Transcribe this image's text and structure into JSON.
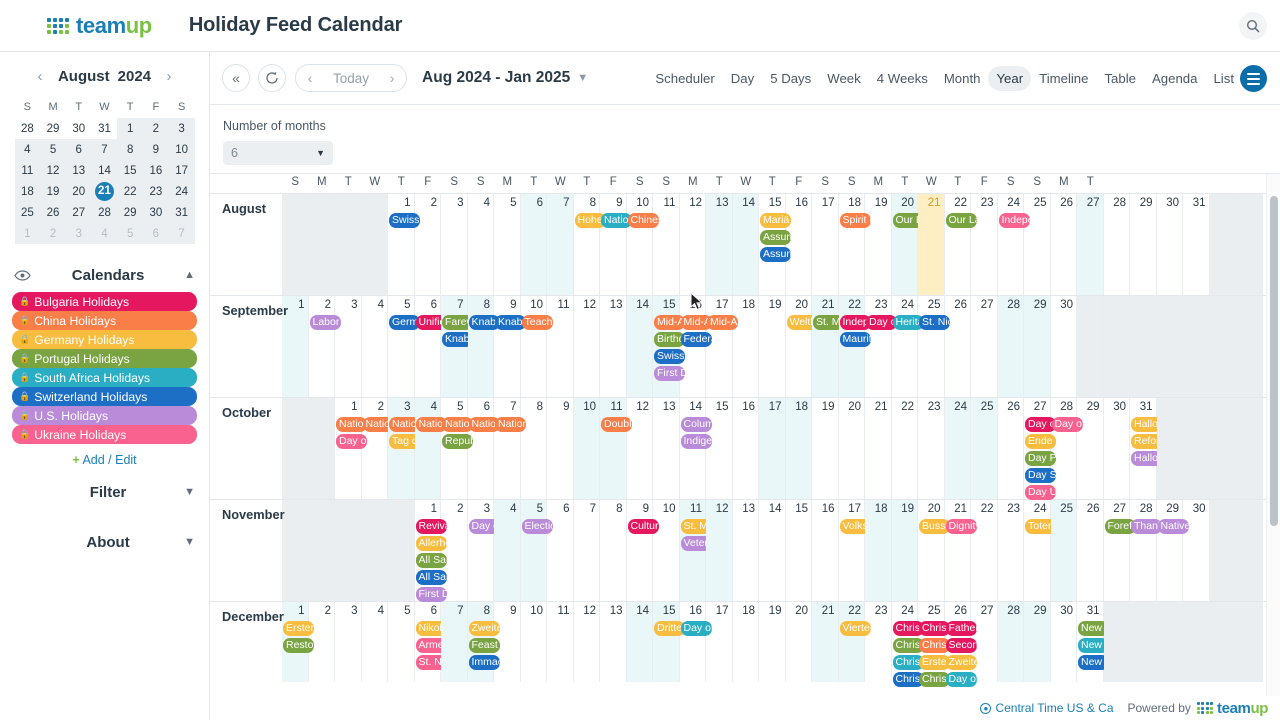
{
  "header": {
    "brand": "teamup",
    "brand_part1": "team",
    "brand_part2": "up",
    "title": "Holiday Feed Calendar",
    "search_icon": "search-icon"
  },
  "sidebar": {
    "mini_calendar": {
      "prev_icon": "chevron-left-icon",
      "next_icon": "chevron-right-icon",
      "month": "August",
      "year": "2024",
      "weekday_headers": [
        "S",
        "M",
        "T",
        "W",
        "T",
        "F",
        "S"
      ],
      "weeks": [
        [
          {
            "d": "28",
            "out": true
          },
          {
            "d": "29",
            "out": true
          },
          {
            "d": "30",
            "out": true
          },
          {
            "d": "31",
            "out": true
          },
          {
            "d": "1"
          },
          {
            "d": "2"
          },
          {
            "d": "3"
          }
        ],
        [
          {
            "d": "4"
          },
          {
            "d": "5"
          },
          {
            "d": "6"
          },
          {
            "d": "7"
          },
          {
            "d": "8"
          },
          {
            "d": "9"
          },
          {
            "d": "10"
          }
        ],
        [
          {
            "d": "11"
          },
          {
            "d": "12"
          },
          {
            "d": "13"
          },
          {
            "d": "14"
          },
          {
            "d": "15"
          },
          {
            "d": "16"
          },
          {
            "d": "17"
          }
        ],
        [
          {
            "d": "18"
          },
          {
            "d": "19"
          },
          {
            "d": "20"
          },
          {
            "d": "21",
            "today": true
          },
          {
            "d": "22"
          },
          {
            "d": "23"
          },
          {
            "d": "24"
          }
        ],
        [
          {
            "d": "25"
          },
          {
            "d": "26"
          },
          {
            "d": "27"
          },
          {
            "d": "28"
          },
          {
            "d": "29"
          },
          {
            "d": "30"
          },
          {
            "d": "31"
          }
        ],
        [
          {
            "d": "1",
            "out": true
          },
          {
            "d": "2",
            "out": true
          },
          {
            "d": "3",
            "out": true
          },
          {
            "d": "4",
            "out": true
          },
          {
            "d": "5",
            "out": true
          },
          {
            "d": "6",
            "out": true
          },
          {
            "d": "7",
            "out": true
          }
        ]
      ]
    },
    "calendars_section": {
      "title": "Calendars",
      "eye_icon": "eye-icon",
      "collapse_icon": "chevron-up-icon",
      "items": [
        {
          "label": "Bulgaria Holidays",
          "color": "#e5175e",
          "locked": true
        },
        {
          "label": "China Holidays",
          "color": "#f97e48",
          "locked": true
        },
        {
          "label": "Germany Holidays",
          "color": "#f8bc3e",
          "locked": true
        },
        {
          "label": "Portugal Holidays",
          "color": "#79a441",
          "locked": true
        },
        {
          "label": "South Africa Holidays",
          "color": "#2aaec4",
          "locked": true
        },
        {
          "label": "Switzerland Holidays",
          "color": "#1d6fc6",
          "locked": true
        },
        {
          "label": "U.S. Holidays",
          "color": "#b98bd8",
          "locked": true
        },
        {
          "label": "Ukraine Holidays",
          "color": "#f9628f",
          "locked": true
        }
      ],
      "add_edit": {
        "plus": "+",
        "label": "Add / Edit"
      }
    },
    "filter_section": {
      "title": "Filter",
      "icon": "chevron-down-icon"
    },
    "about_section": {
      "title": "About",
      "icon": "chevron-down-icon"
    }
  },
  "toolbar": {
    "collapse_icon": "double-chevron-left-icon",
    "refresh_icon": "refresh-icon",
    "prev_icon": "chevron-left-icon",
    "today_label": "Today",
    "next_icon": "chevron-right-icon",
    "range_label": "Aug 2024 - Jan 2025",
    "range_chevron": "chevron-down-icon",
    "views": [
      {
        "label": "Scheduler",
        "active": false
      },
      {
        "label": "Day",
        "active": false
      },
      {
        "label": "5 Days",
        "active": false
      },
      {
        "label": "Week",
        "active": false
      },
      {
        "label": "4 Weeks",
        "active": false
      },
      {
        "label": "Month",
        "active": false
      },
      {
        "label": "Year",
        "active": true
      },
      {
        "label": "Timeline",
        "active": false
      },
      {
        "label": "Table",
        "active": false
      },
      {
        "label": "Agenda",
        "active": false
      },
      {
        "label": "List",
        "active": false
      }
    ],
    "menu_icon": "hamburger-menu-icon"
  },
  "subbar": {
    "months_label": "Number of months",
    "months_value": "6",
    "months_arrow": "caret-down-icon"
  },
  "year_grid": {
    "weekday_headers": [
      "S",
      "M",
      "T",
      "W",
      "T",
      "F",
      "S",
      "S",
      "M",
      "T",
      "W",
      "T",
      "F",
      "S",
      "S",
      "M",
      "T",
      "W",
      "T",
      "F",
      "S",
      "S",
      "M",
      "T",
      "W",
      "T",
      "F",
      "S",
      "S",
      "M",
      "T"
    ],
    "months": [
      {
        "name": "August",
        "pad_before": 4,
        "days": 31,
        "weekend_offsets": [
          2,
          3,
          9,
          10,
          16,
          17,
          23,
          24,
          30
        ],
        "today": 21,
        "events": {
          "1": [
            {
              "t": "Swiss National Day",
              "c": "#1d6fc6"
            }
          ],
          "8": [
            {
              "t": "Hohe Feiertage",
              "c": "#f8bc3e"
            }
          ],
          "9": [
            {
              "t": "National Women's Day",
              "c": "#2aaec4"
            }
          ],
          "10": [
            {
              "t": "Chinese Valentine's Day",
              "c": "#f97e48"
            }
          ],
          "15": [
            {
              "t": "Mariä Himmelfahrt",
              "c": "#f8bc3e"
            },
            {
              "t": "Assumption of Mary",
              "c": "#79a441"
            },
            {
              "t": "Assumption",
              "c": "#1d6fc6"
            }
          ],
          "18": [
            {
              "t": "Spirit Festival",
              "c": "#f97e48"
            }
          ],
          "20": [
            {
              "t": "Our Lady of Sorrows",
              "c": "#79a441"
            }
          ],
          "22": [
            {
              "t": "Our Lady",
              "c": "#79a441"
            }
          ],
          "24": [
            {
              "t": "Independence Day",
              "c": "#f9628f"
            }
          ]
        }
      },
      {
        "name": "September",
        "pad_before": 0,
        "days": 30,
        "weekend_offsets": [
          0,
          6,
          7,
          13,
          14,
          20,
          21,
          27,
          28
        ],
        "events": {
          "2": [
            {
              "t": "Labor Day",
              "c": "#b98bd8"
            }
          ],
          "5": [
            {
              "t": "Germany Holiday",
              "c": "#1d6fc6"
            }
          ],
          "6": [
            {
              "t": "Unification Day",
              "c": "#e5175e"
            }
          ],
          "7": [
            {
              "t": "Farewell",
              "c": "#79a441"
            },
            {
              "t": "Knabenschiessen",
              "c": "#1d6fc6"
            }
          ],
          "8": [
            {
              "t": "Knabenschiessen",
              "c": "#1d6fc6"
            }
          ],
          "9": [
            {
              "t": "Knabenschiessen",
              "c": "#1d6fc6"
            }
          ],
          "10": [
            {
              "t": "Teacher's Day",
              "c": "#f97e48"
            }
          ],
          "15": [
            {
              "t": "Mid-Autumn Festival",
              "c": "#f97e48"
            },
            {
              "t": "Birthday",
              "c": "#79a441"
            },
            {
              "t": "Swiss Holiday",
              "c": "#1d6fc6"
            },
            {
              "t": "First Day",
              "c": "#b98bd8"
            }
          ],
          "16": [
            {
              "t": "Mid-Autumn Festival",
              "c": "#f97e48"
            },
            {
              "t": "Federal Fast",
              "c": "#1d6fc6"
            }
          ],
          "17": [
            {
              "t": "Mid-Autumn Festival",
              "c": "#f97e48"
            }
          ],
          "20": [
            {
              "t": "Weltkindertag",
              "c": "#f8bc3e"
            }
          ],
          "21": [
            {
              "t": "St. Matthew",
              "c": "#79a441"
            }
          ],
          "22": [
            {
              "t": "Independence Day",
              "c": "#e5175e"
            },
            {
              "t": "Mauritius",
              "c": "#1d6fc6"
            }
          ],
          "23": [
            {
              "t": "Day of Unity",
              "c": "#e5175e"
            }
          ],
          "24": [
            {
              "t": "Heritage Day",
              "c": "#2aaec4"
            }
          ],
          "25": [
            {
              "t": "St. Nicholas",
              "c": "#1d6fc6"
            }
          ]
        }
      },
      {
        "name": "October",
        "pad_before": 2,
        "days": 31,
        "weekend_offsets": [
          4,
          5,
          11,
          12,
          18,
          19,
          25,
          26
        ],
        "events": {
          "1": [
            {
              "t": "National Day",
              "c": "#f97e48"
            },
            {
              "t": "Day of Defenders",
              "c": "#f9628f"
            }
          ],
          "2": [
            {
              "t": "National Day",
              "c": "#f97e48"
            }
          ],
          "3": [
            {
              "t": "National Day",
              "c": "#f97e48"
            },
            {
              "t": "Tag der Einheit",
              "c": "#f8bc3e"
            }
          ],
          "4": [
            {
              "t": "National Day",
              "c": "#f97e48"
            }
          ],
          "5": [
            {
              "t": "National Day",
              "c": "#f97e48"
            },
            {
              "t": "Republic Day",
              "c": "#79a441"
            }
          ],
          "6": [
            {
              "t": "National Day",
              "c": "#f97e48"
            }
          ],
          "7": [
            {
              "t": "National Day",
              "c": "#f97e48"
            }
          ],
          "11": [
            {
              "t": "Double Ninth Festival",
              "c": "#f97e48"
            }
          ],
          "14": [
            {
              "t": "Columbus Day",
              "c": "#b98bd8"
            },
            {
              "t": "Indigenous Peoples Day",
              "c": "#b98bd8"
            }
          ],
          "27": [
            {
              "t": "Day of Remembrance",
              "c": "#e5175e"
            },
            {
              "t": "Ende der Sommerzeit",
              "c": "#f8bc3e"
            },
            {
              "t": "Day Portugal",
              "c": "#79a441"
            },
            {
              "t": "Day Switzerland",
              "c": "#1d6fc6"
            },
            {
              "t": "Day Ukraine",
              "c": "#f9628f"
            }
          ],
          "28": [
            {
              "t": "Day of Liberation",
              "c": "#f9628f"
            }
          ],
          "31": [
            {
              "t": "Halloween",
              "c": "#f8bc3e"
            },
            {
              "t": "Reformationstag",
              "c": "#f8bc3e"
            },
            {
              "t": "Halloween",
              "c": "#b98bd8"
            }
          ]
        }
      },
      {
        "name": "November",
        "pad_before": 5,
        "days": 30,
        "weekend_offsets": [
          1,
          2,
          8,
          9,
          15,
          16,
          22,
          23,
          29
        ],
        "events": {
          "1": [
            {
              "t": "Revival Leaders Day",
              "c": "#e5175e"
            },
            {
              "t": "Allerheiligen",
              "c": "#f8bc3e"
            },
            {
              "t": "All Saints' Day",
              "c": "#79a441"
            },
            {
              "t": "All Saints",
              "c": "#1d6fc6"
            },
            {
              "t": "First Day",
              "c": "#b98bd8"
            }
          ],
          "3": [
            {
              "t": "Day of Culture",
              "c": "#b98bd8"
            }
          ],
          "5": [
            {
              "t": "Election Day",
              "c": "#b98bd8"
            }
          ],
          "9": [
            {
              "t": "Cultural Day",
              "c": "#e5175e"
            }
          ],
          "11": [
            {
              "t": "St. Martin",
              "c": "#f8bc3e"
            },
            {
              "t": "Veterans Day",
              "c": "#b98bd8"
            }
          ],
          "17": [
            {
              "t": "Volkstrauertag",
              "c": "#f8bc3e"
            }
          ],
          "20": [
            {
              "t": "Buss- und Bettag",
              "c": "#f8bc3e"
            }
          ],
          "21": [
            {
              "t": "Dignity and Freedom Day",
              "c": "#f9628f"
            }
          ],
          "24": [
            {
              "t": "Totensonntag",
              "c": "#f8bc3e"
            }
          ],
          "27": [
            {
              "t": "Forefathers",
              "c": "#79a441"
            }
          ],
          "28": [
            {
              "t": "Thanksgiving Day",
              "c": "#b98bd8"
            }
          ],
          "29": [
            {
              "t": "Native American Day",
              "c": "#b98bd8"
            }
          ]
        }
      },
      {
        "name": "December",
        "pad_before": 0,
        "days": 31,
        "weekend_offsets": [
          0,
          6,
          7,
          13,
          14,
          20,
          21,
          27,
          28
        ],
        "events": {
          "1": [
            {
              "t": "Erster Advent",
              "c": "#f8bc3e"
            },
            {
              "t": "Restoration Day",
              "c": "#79a441"
            }
          ],
          "6": [
            {
              "t": "Nikolaus",
              "c": "#f8bc3e"
            },
            {
              "t": "Armed Forces Day",
              "c": "#f9628f"
            },
            {
              "t": "St. Nicholas",
              "c": "#f9628f"
            }
          ],
          "8": [
            {
              "t": "Zweiter Advent",
              "c": "#f8bc3e"
            },
            {
              "t": "Feast of Immaculate",
              "c": "#79a441"
            },
            {
              "t": "Immaculate Conception",
              "c": "#1d6fc6"
            }
          ],
          "15": [
            {
              "t": "Dritter Advent",
              "c": "#f8bc3e"
            }
          ],
          "16": [
            {
              "t": "Day of Reconciliation",
              "c": "#2aaec4"
            }
          ],
          "22": [
            {
              "t": "Vierter Advent",
              "c": "#f8bc3e"
            }
          ],
          "24": [
            {
              "t": "Christmas Eve",
              "c": "#e5175e"
            },
            {
              "t": "Christmas Eve",
              "c": "#79a441"
            },
            {
              "t": "Christmas Eve",
              "c": "#2aaec4"
            },
            {
              "t": "Christmas",
              "c": "#1d6fc6"
            }
          ],
          "25": [
            {
              "t": "Christmas Day",
              "c": "#e5175e"
            },
            {
              "t": "Christmas Day",
              "c": "#f97e48"
            },
            {
              "t": "Erster Weihnachtstag",
              "c": "#f8bc3e"
            },
            {
              "t": "Christmas",
              "c": "#79a441"
            }
          ],
          "26": [
            {
              "t": "Father's Day",
              "c": "#e5175e"
            },
            {
              "t": "Second Christmas Day",
              "c": "#e5175e"
            },
            {
              "t": "Zweiter Weihnachtstag",
              "c": "#f8bc3e"
            },
            {
              "t": "Day of Goodwill",
              "c": "#2aaec4"
            }
          ],
          "31": [
            {
              "t": "New Year's Eve",
              "c": "#79a441"
            },
            {
              "t": "New Year's Eve",
              "c": "#2aaec4"
            },
            {
              "t": "New Year's Eve",
              "c": "#1d6fc6"
            }
          ]
        }
      }
    ]
  },
  "footer": {
    "timezone": "Central Time US & Ca",
    "timezone_icon": "clock-icon",
    "powered_by": "Powered by",
    "brand_part1": "team",
    "brand_part2": "up"
  }
}
